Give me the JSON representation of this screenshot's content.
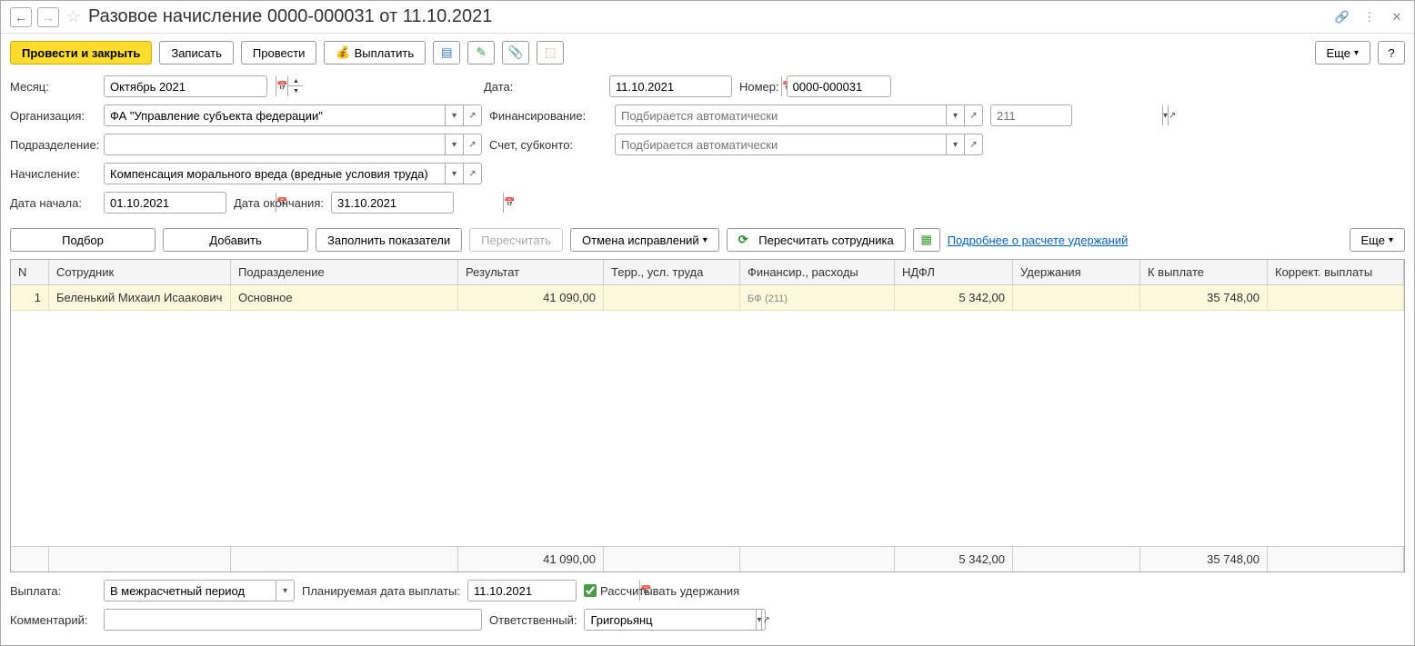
{
  "title": "Разовое начисление 0000-000031 от 11.10.2021",
  "toolbar": {
    "post_close": "Провести и закрыть",
    "save": "Записать",
    "post": "Провести",
    "payout": "Выплатить",
    "more": "Еще"
  },
  "labels": {
    "month": "Месяц:",
    "date": "Дата:",
    "number": "Номер:",
    "org": "Организация:",
    "financing": "Финансирование:",
    "department": "Подразделение:",
    "account": "Счет, субконто:",
    "accrual": "Начисление:",
    "date_start": "Дата начала:",
    "date_end": "Дата окончания:",
    "payout": "Выплата:",
    "planned_date": "Планируемая дата выплаты:",
    "calc_ded": "Рассчитывать удержания",
    "comment": "Комментарий:",
    "responsible": "Ответственный:"
  },
  "fields": {
    "month": "Октябрь 2021",
    "date": "11.10.2021",
    "number": "0000-000031",
    "org": "ФА \"Управление субъекта федерации\"",
    "financing_ph": "Подбирается автоматически",
    "account_ph": "Подбирается автоматически",
    "code211": "211",
    "accrual": "Компенсация морального вреда (вредные условия труда)",
    "date_start": "01.10.2021",
    "date_end": "31.10.2021",
    "payout_mode": "В межрасчетный период",
    "planned_date": "11.10.2021",
    "responsible": "Григорьянц"
  },
  "table_toolbar": {
    "select": "Подбор",
    "add": "Добавить",
    "fill": "Заполнить показатели",
    "recalc": "Пересчитать",
    "cancel_fix": "Отмена исправлений",
    "recalc_emp": "Пересчитать сотрудника",
    "link": "Подробнее о расчете удержаний",
    "more": "Еще"
  },
  "columns": {
    "n": "N",
    "employee": "Сотрудник",
    "department": "Подразделение",
    "result": "Результат",
    "territory": "Терр., усл. труда",
    "financing": "Финансир., расходы",
    "ndfl": "НДФЛ",
    "deductions": "Удержания",
    "topay": "К выплате",
    "correct": "Коррект. выплаты"
  },
  "rows": [
    {
      "n": "1",
      "employee": "Беленький Михаил Исаакович",
      "department": "Основное",
      "result": "41 090,00",
      "territory": "",
      "financing_code": "БФ",
      "financing_acc": "(211)",
      "ndfl": "5 342,00",
      "deductions": "",
      "topay": "35 748,00",
      "correct": ""
    }
  ],
  "totals": {
    "result": "41 090,00",
    "ndfl": "5 342,00",
    "topay": "35 748,00"
  }
}
